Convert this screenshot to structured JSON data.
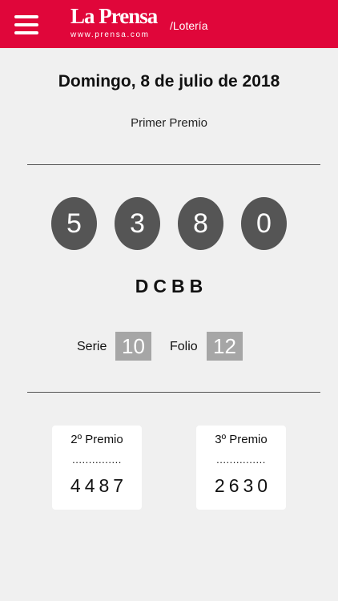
{
  "header": {
    "brand_name": "La Prensa",
    "brand_url": "www.prensa.com",
    "section": "/Lotería"
  },
  "draw": {
    "date": "Domingo,  8 de julio de 2018",
    "first_prize_label": "Primer Premio",
    "first_prize_digits": [
      "5",
      "3",
      "8",
      "0"
    ],
    "letters": "DCBB",
    "serie_label": "Serie",
    "serie_value": "10",
    "folio_label": "Folio",
    "folio_value": "12"
  },
  "secondary_prizes": [
    {
      "label": "2º Premio",
      "dots": "...............",
      "number": "4487"
    },
    {
      "label": "3º Premio",
      "dots": "...............",
      "number": "2630"
    }
  ],
  "colors": {
    "brand_red": "#e0063a",
    "ball": "#555555",
    "meta_box": "#a6a6a6",
    "background": "#f0f0f0"
  }
}
